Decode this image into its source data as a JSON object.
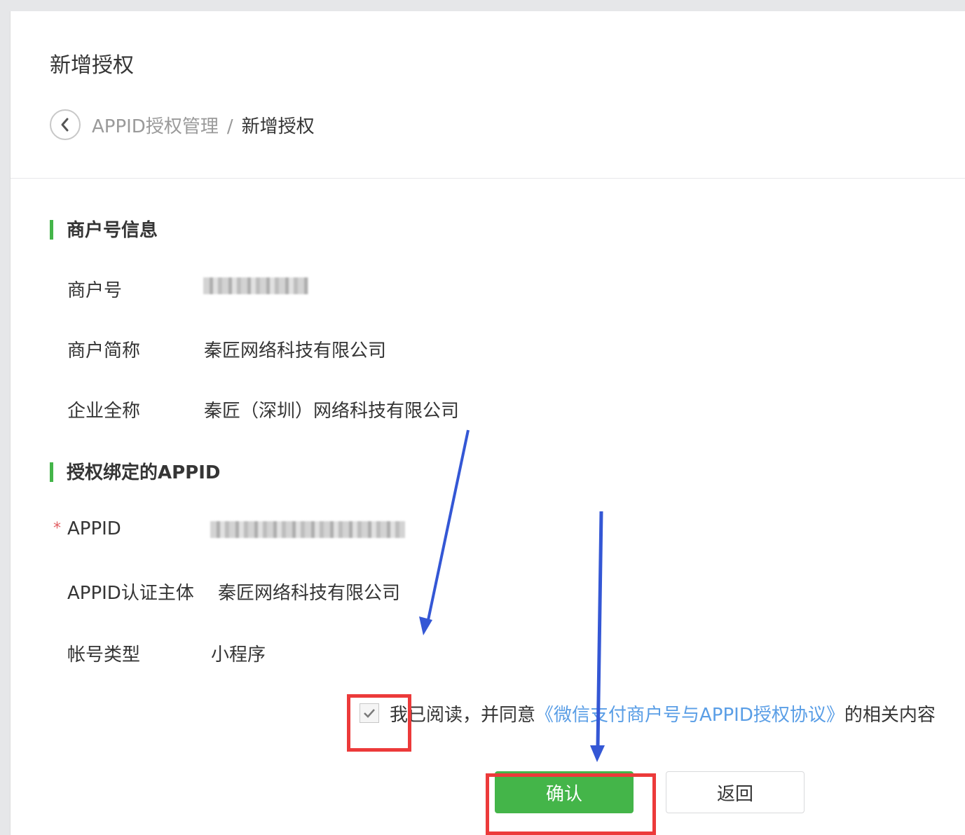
{
  "page": {
    "title": "新增授权"
  },
  "breadcrumb": {
    "back_icon": "chevron-left-icon",
    "parent": "APPID授权管理",
    "separator": "/",
    "current": "新增授权"
  },
  "merchant_section": {
    "title": "商户号信息",
    "fields": [
      {
        "label": "商户号",
        "value": ""
      },
      {
        "label": "商户简称",
        "value": "秦匠网络科技有限公司"
      },
      {
        "label": "企业全称",
        "value": "秦匠（深圳）网络科技有限公司"
      }
    ]
  },
  "appid_section": {
    "title": "授权绑定的APPID",
    "required_mark": "*",
    "fields": [
      {
        "label": "APPID",
        "value": ""
      },
      {
        "label": "APPID认证主体",
        "value": "秦匠网络科技有限公司"
      },
      {
        "label": "帐号类型",
        "value": "小程序"
      }
    ]
  },
  "agreement": {
    "checked": true,
    "prefix": "我已阅读，并同意",
    "link": "《微信支付商户号与APPID授权协议》",
    "suffix": "的相关内容"
  },
  "buttons": {
    "confirm": "确认",
    "back": "返回"
  },
  "colors": {
    "accent_green": "#44b549",
    "link_blue": "#5a9ee6",
    "highlight_red": "#ec3a3a",
    "annotation_arrow": "#3457d5"
  }
}
